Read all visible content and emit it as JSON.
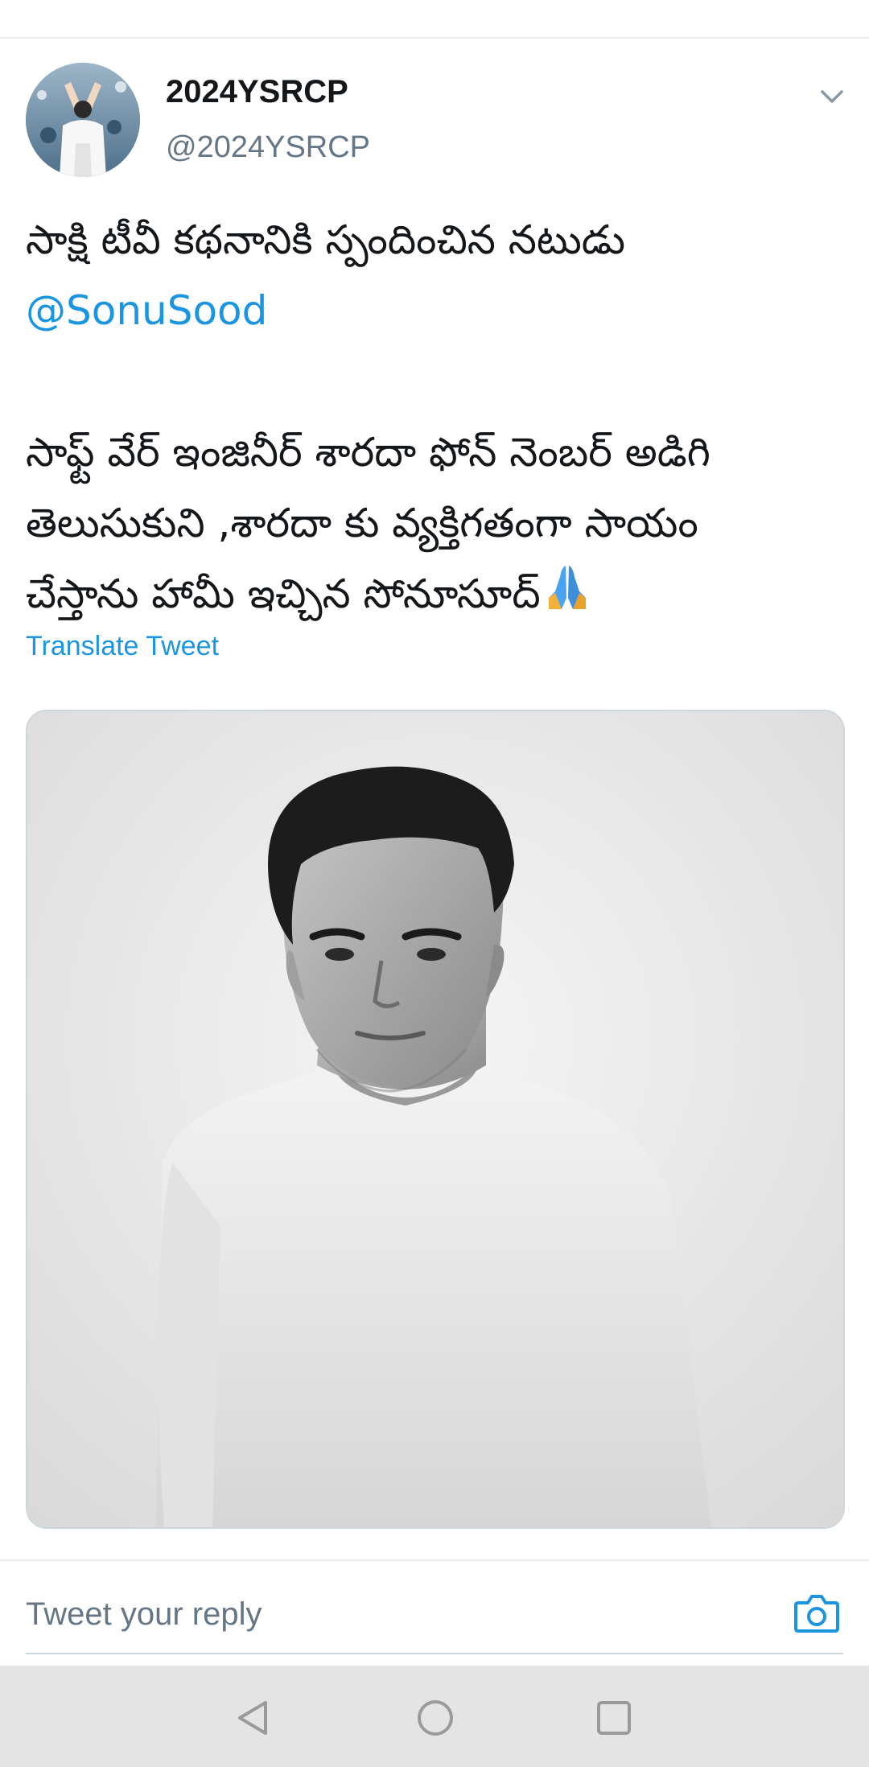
{
  "tweet": {
    "author_name": "2024YSRCP",
    "author_handle": "@2024YSRCP",
    "text_line1": "సాక్షి టీవీ కథనానికి స్పందించిన నటుడు",
    "mention": "@SonuSood",
    "text_line3": "సాఫ్ట్ వేర్ ఇంజినీర్ శారదా ఫోన్ నెంబర్ అడిగి",
    "text_line4": "తెలుసుకుని ,శారదా కు వ్యక్తిగతంగా సాయం",
    "text_line5": "చేస్తాను హామీ ఇచ్చిన సోనూసూద్",
    "emoji": "folded-hands",
    "translate_label": "Translate Tweet"
  },
  "reply": {
    "placeholder": "Tweet your reply"
  },
  "icons": {
    "caret": "chevron-down-icon",
    "camera": "camera-icon",
    "nav_back": "back-triangle-icon",
    "nav_home": "home-circle-icon",
    "nav_recents": "recents-square-icon"
  },
  "colors": {
    "link": "#1b95e0",
    "text": "#14171a",
    "secondary": "#657786"
  }
}
